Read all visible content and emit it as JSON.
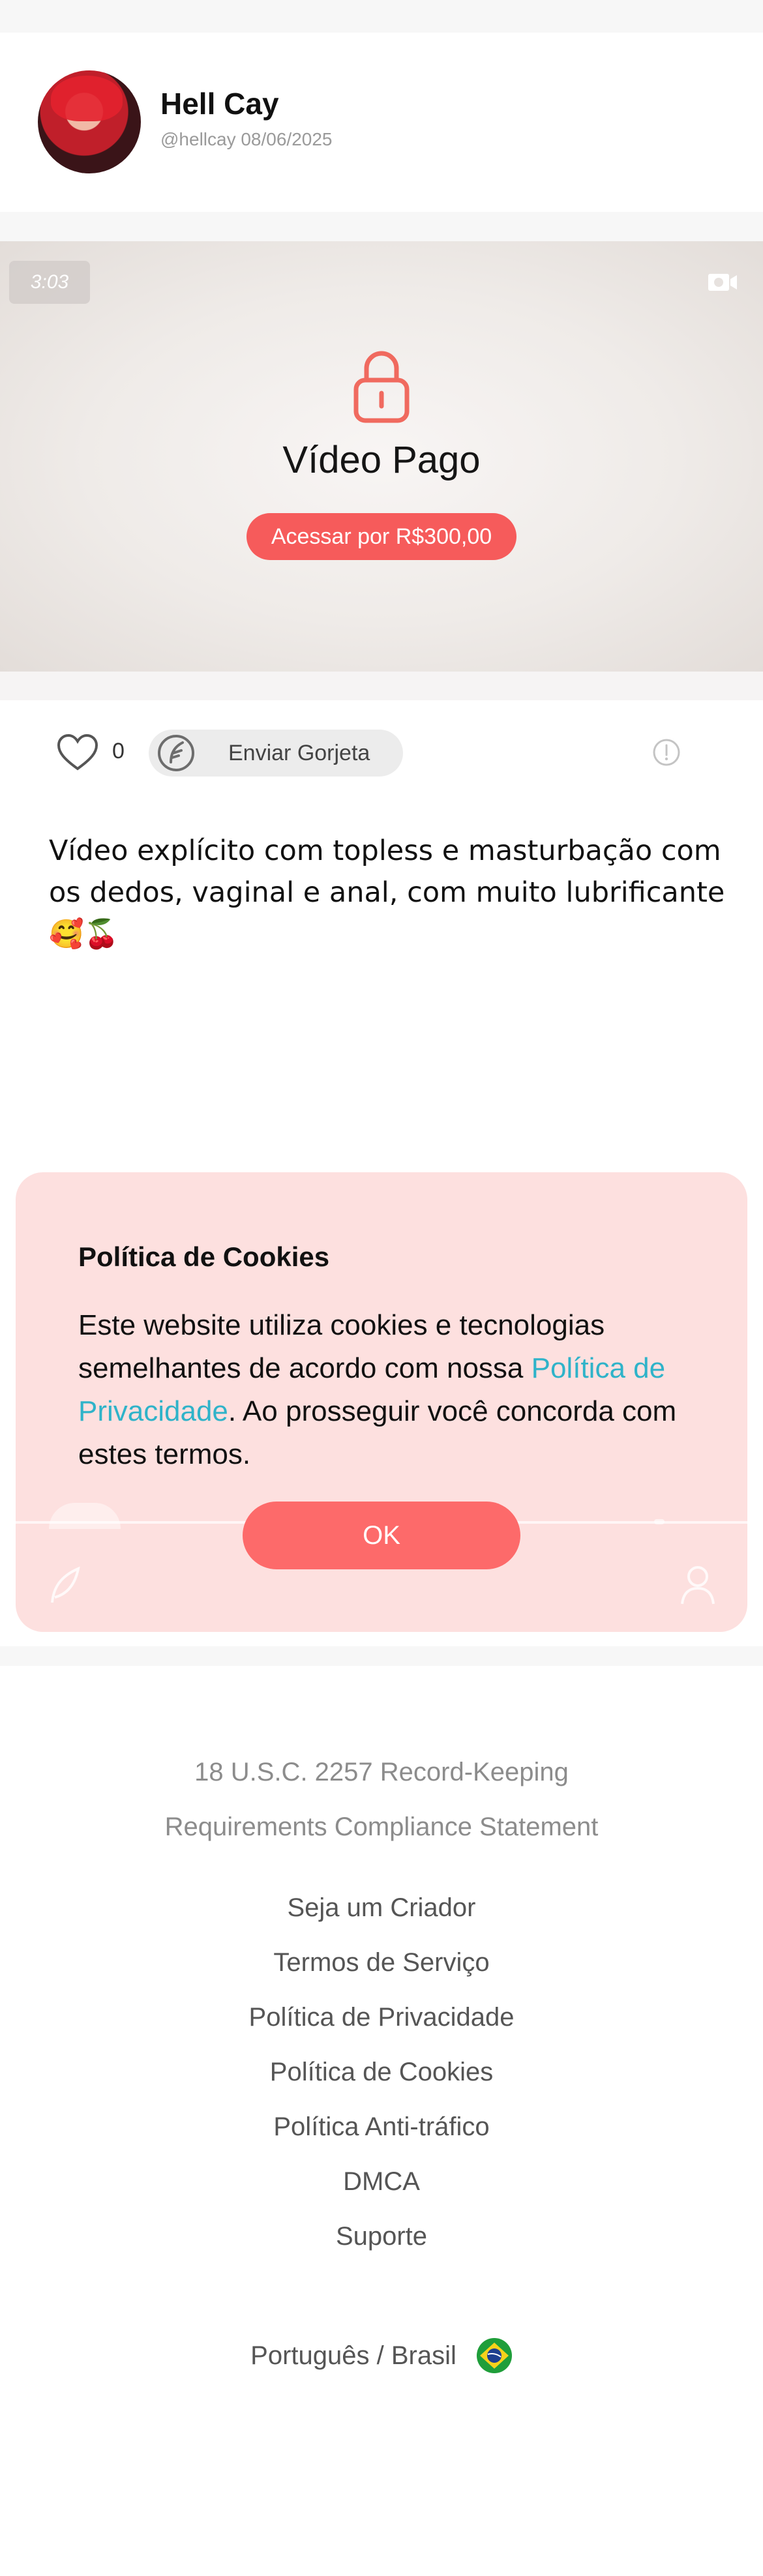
{
  "post": {
    "creator_name": "Hell Cay",
    "creator_meta": "@hellcay 08/06/2025",
    "video": {
      "duration": "3:03",
      "paid_title": "Vídeo Pago",
      "access_label": "Acessar por R$300,00"
    },
    "likes": "0",
    "tip_label": "Enviar Gorjeta",
    "text": "Vídeo explícito com topless e masturbação com os dedos, vaginal e anal, com muito lubrificante 🥰🍒"
  },
  "cookie_banner": {
    "title": "Política de Cookies",
    "body_before": "Este website utiliza cookies e tecnologias semelhantes de acordo com nossa ",
    "link_text": "Política de Privacidade",
    "body_after": ". Ao prosseguir você concorda com estes termos.",
    "ok_label": "OK"
  },
  "footer": {
    "compliance_line1": "18 U.S.C. 2257 Record-Keeping",
    "compliance_line2": "Requirements Compliance Statement",
    "links": [
      "Seja um Criador",
      "Termos de Serviço",
      "Política de Privacidade",
      "Política de Cookies",
      "Política Anti-tráfico",
      "DMCA",
      "Suporte"
    ],
    "language": "Português / Brasil"
  },
  "colors": {
    "accent": "#f65b5b",
    "link": "#2fb3c9",
    "banner_bg": "#fde0df"
  },
  "icons": [
    "camera-icon",
    "lock-icon",
    "heart-icon",
    "tip-icon",
    "info-icon",
    "brazil-flag-icon"
  ]
}
